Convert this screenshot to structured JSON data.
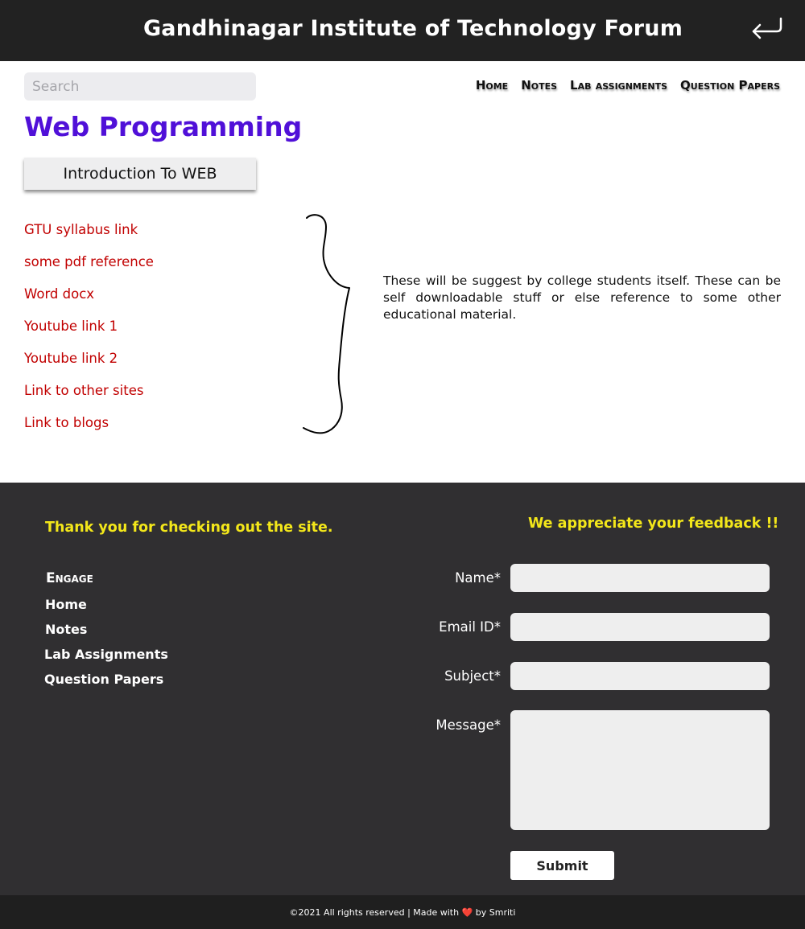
{
  "header": {
    "title": "Gandhinagar Institute of Technology Forum",
    "back_icon": "return-arrow-icon"
  },
  "search": {
    "placeholder": "Search",
    "value": ""
  },
  "nav": {
    "items": [
      "Home",
      "Notes",
      "Lab assignments",
      "Question Papers"
    ]
  },
  "main": {
    "title": "Web Programming",
    "topic_button": "Introduction To WEB",
    "links": [
      "GTU syllabus link",
      "some pdf reference",
      "Word docx",
      "Youtube link 1",
      "Youtube link 2",
      "Link to other sites",
      "Link to blogs"
    ],
    "note": "These will be suggest by college students itself. These can be self downloadable stuff or else reference to some other educational material."
  },
  "footer": {
    "thanks": "Thank you for checking out the site.",
    "engage_heading": "Engage",
    "links": [
      "Home",
      "Notes",
      "Lab Assignments",
      "Question Papers"
    ],
    "feedback_title": "We appreciate your feedback !!",
    "form": {
      "name_label": "Name*",
      "email_label": "Email ID*",
      "subject_label": "Subject*",
      "message_label": "Message*",
      "submit_label": "Submit"
    },
    "copyright_before": "©2021 All rights reserved | Made with",
    "heart": "❤️",
    "copyright_after": "by Smriti"
  },
  "colors": {
    "header_bg": "#222222",
    "title_purple": "#5010d8",
    "link_red": "#c10000",
    "footer_bg": "#302f31",
    "footer_yellow": "#f3e71a"
  }
}
